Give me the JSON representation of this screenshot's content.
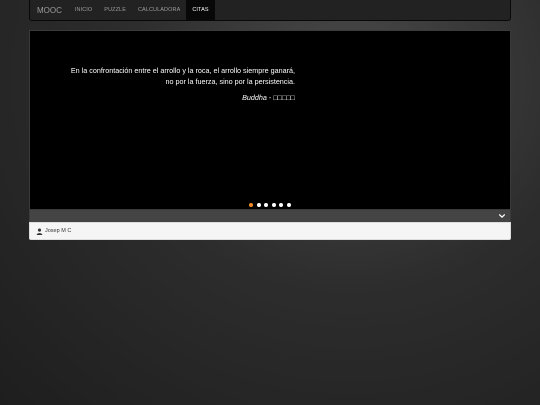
{
  "navbar": {
    "brand": "MOOC",
    "items": [
      {
        "label": "INICIO",
        "active": false
      },
      {
        "label": "PUZZLE",
        "active": false
      },
      {
        "label": "CALCULADORA",
        "active": false
      },
      {
        "label": "CITAS",
        "active": true
      }
    ]
  },
  "carousel": {
    "quote_line1": "En la confrontación entre el arrollo y la roca, el arrollo siempre ganará,",
    "quote_line2": "no por la fuerza, sino por la persistencia.",
    "author_name": "Buddha",
    "author_separator": " - ",
    "author_extra": "□□□□□",
    "slide_count": 6,
    "active_slide": 1
  },
  "collapse": {
    "icon": "chevron-down-icon"
  },
  "footer": {
    "icon": "user-icon",
    "name": "Josep M C"
  },
  "colors": {
    "navbar_bg": "#222222",
    "active_indicator": "#f08a24",
    "footer_bg": "#f5f5f5"
  }
}
